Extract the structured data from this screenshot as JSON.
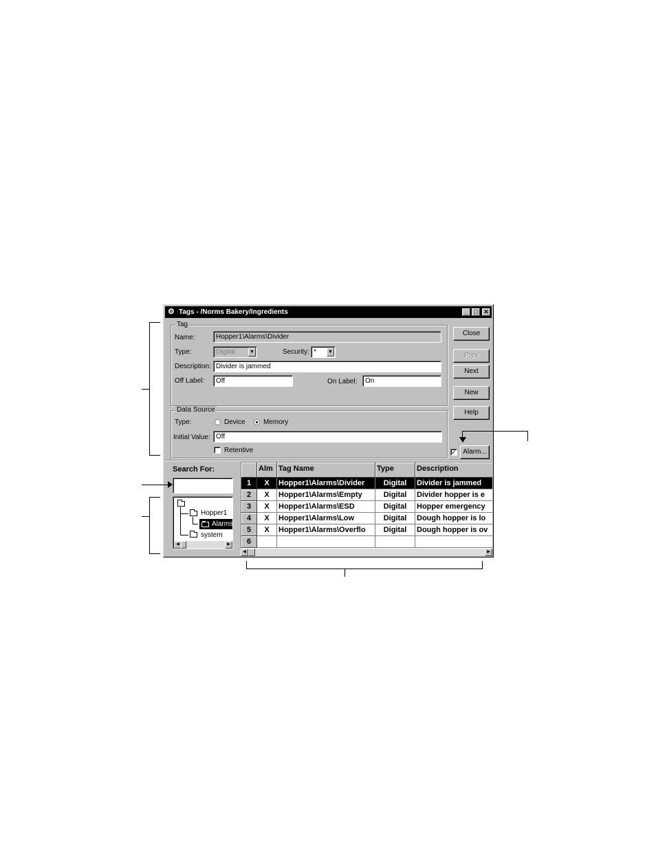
{
  "window": {
    "title": "Tags - /Norms Bakery/Ingredients",
    "minimize_glyph": "_",
    "maximize_glyph": "□",
    "close_glyph": "✕"
  },
  "tag_group": {
    "legend": "Tag",
    "name_label": "Name:",
    "name_value": "Hopper1\\Alarms\\Divider",
    "type_label": "Type:",
    "type_value": "Digital",
    "security_label": "Security:",
    "security_value": "*",
    "description_label": "Description:",
    "description_value": "Divider is jammed",
    "off_label_label": "Off Label:",
    "off_label_value": "Off",
    "on_label_label": "On Label:",
    "on_label_value": "On"
  },
  "data_source_group": {
    "legend": "Data Source",
    "type_label": "Type:",
    "device_label": "Device",
    "memory_label": "Memory",
    "selected": "Memory",
    "initial_value_label": "Initial Value:",
    "initial_value_value": "Off",
    "retentive_label": "Retentive",
    "retentive_checked": false
  },
  "buttons": {
    "close": "Close",
    "prev": "Prev",
    "next": "Next",
    "new": "New",
    "help": "Help",
    "alarm": "Alarm...",
    "alarm_checked": true
  },
  "search": {
    "label": "Search For:",
    "value": ""
  },
  "tree": {
    "items": [
      {
        "label": ""
      },
      {
        "label": "Hopper1"
      },
      {
        "label": "Alarms"
      },
      {
        "label": "system"
      }
    ]
  },
  "grid": {
    "columns": [
      "Alm",
      "Tag Name",
      "Type",
      "Description"
    ],
    "rows": [
      {
        "num": "1",
        "alm": "X",
        "tag": "Hopper1\\Alarms\\Divider",
        "type": "Digital",
        "desc": "Divider is jammed",
        "selected": true
      },
      {
        "num": "2",
        "alm": "X",
        "tag": "Hopper1\\Alarms\\Empty",
        "type": "Digital",
        "desc": "Divider hopper is e",
        "selected": false
      },
      {
        "num": "3",
        "alm": "X",
        "tag": "Hopper1\\Alarms\\ESD",
        "type": "Digital",
        "desc": "Hopper emergency",
        "selected": false
      },
      {
        "num": "4",
        "alm": "X",
        "tag": "Hopper1\\Alarms\\Low",
        "type": "Digital",
        "desc": "Dough hopper is lo",
        "selected": false
      },
      {
        "num": "5",
        "alm": "X",
        "tag": "Hopper1\\Alarms\\Overflo",
        "type": "Digital",
        "desc": "Dough hopper is ov",
        "selected": false
      },
      {
        "num": "6",
        "alm": "",
        "tag": "",
        "type": "",
        "desc": "",
        "selected": false
      }
    ]
  },
  "scroll": {
    "left_glyph": "◀",
    "right_glyph": "▶"
  }
}
